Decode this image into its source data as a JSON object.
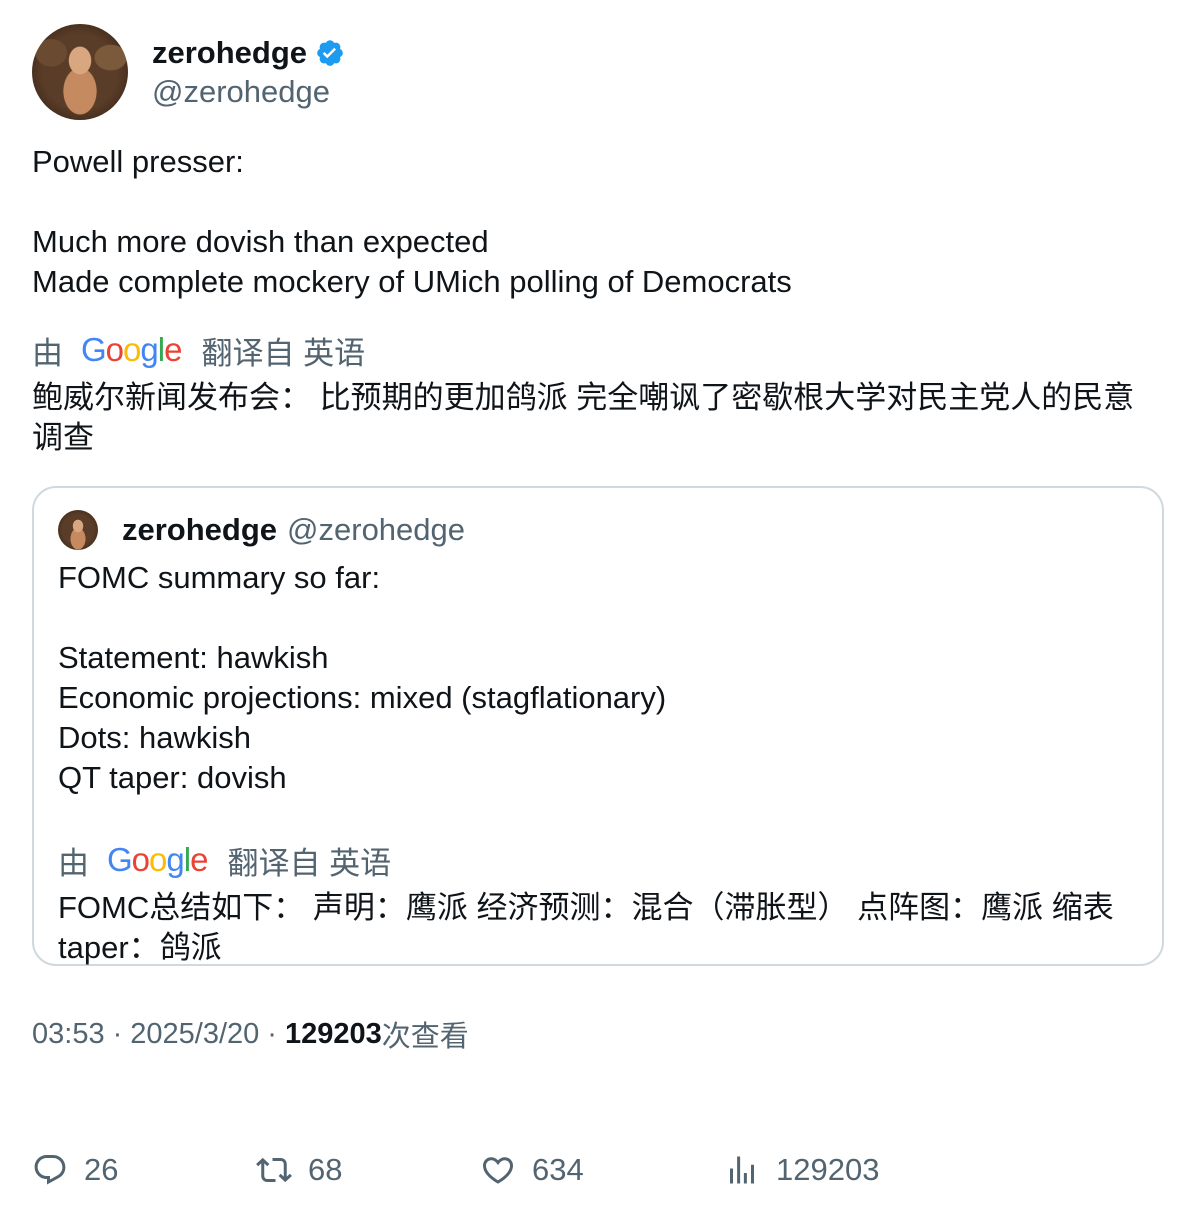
{
  "author": {
    "display_name": "zerohedge",
    "handle": "@zerohedge",
    "verified_color": "#1d9bf0"
  },
  "tweet": {
    "text": "Powell presser:\n\nMuch more dovish than expected\nMade complete mockery of UMich polling of Democrats",
    "translation": {
      "by_label": "由",
      "provider": "Google",
      "from_label": "翻译自 英语",
      "text": "鲍威尔新闻发布会： 比预期的更加鸽派 完全嘲讽了密歇根大学对民主党人的民意调查"
    }
  },
  "quoted_tweet": {
    "display_name": "zerohedge",
    "handle": "@zerohedge",
    "text": "FOMC summary so far:\n\nStatement: hawkish\nEconomic projections: mixed (stagflationary)\nDots: hawkish\nQT taper: dovish",
    "translation": {
      "by_label": "由",
      "provider": "Google",
      "from_label": "翻译自 英语",
      "text": "FOMC总结如下： 声明：鹰派 经济预测：混合（滞胀型） 点阵图：鹰派 缩表 taper：鸽派"
    }
  },
  "meta": {
    "time": "03:53",
    "separator": "·",
    "date": "2025/3/20",
    "views_count": "129203",
    "views_label": "次查看"
  },
  "actions": {
    "replies": "26",
    "reposts": "68",
    "likes": "634",
    "views": "129203"
  },
  "colors": {
    "text_primary": "#0f1419",
    "text_secondary": "#536471",
    "border": "#cfd9de",
    "verified": "#1d9bf0"
  },
  "icons": {
    "verified": "verified-badge-icon",
    "reply": "reply-icon",
    "repost": "repost-icon",
    "like": "heart-icon",
    "views": "analytics-icon"
  }
}
